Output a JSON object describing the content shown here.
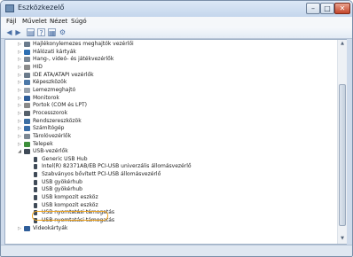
{
  "window": {
    "title": "Eszközkezelő"
  },
  "controls": {
    "minimize": "–",
    "maximize": "□",
    "close": "✕"
  },
  "menu": [
    "Fájl",
    "Művelet",
    "Nézet",
    "Súgó"
  ],
  "toolbar": [
    {
      "icon": "back-arrow-icon",
      "glyph": "◀"
    },
    {
      "icon": "forward-arrow-icon",
      "glyph": "▶"
    },
    {
      "icon": "properties-icon",
      "glyph": "▤"
    },
    {
      "icon": "help-icon",
      "glyph": "?"
    },
    {
      "icon": "list-view-icon",
      "glyph": "▦"
    },
    {
      "icon": "scan-hardware-icon",
      "glyph": "⚙"
    }
  ],
  "tree": {
    "categories": [
      {
        "label": "Hajlékonylemezes meghajtók vezérlői",
        "icon": "floppy-controller-icon",
        "color": "#6b7b8c"
      },
      {
        "label": "Hálózati kártyák",
        "icon": "network-adapter-icon",
        "color": "#2e6fb2"
      },
      {
        "label": "Hang-, videó- és játékvezérlők",
        "icon": "sound-video-icon",
        "color": "#7a8795"
      },
      {
        "label": "HID",
        "icon": "hid-icon",
        "color": "#8c8c8c"
      },
      {
        "label": "IDE ATA/ATAPI vezérlők",
        "icon": "ide-controller-icon",
        "color": "#6b7b8c"
      },
      {
        "label": "Képeszközök",
        "icon": "imaging-device-icon",
        "color": "#4d79a8"
      },
      {
        "label": "Lemezmeghajtó",
        "icon": "disk-drive-icon",
        "color": "#9aa3ad"
      },
      {
        "label": "Monitorok",
        "icon": "monitor-icon",
        "color": "#2f5e9a"
      },
      {
        "label": "Portok (COM és LPT)",
        "icon": "port-icon",
        "color": "#8a8a8a"
      },
      {
        "label": "Processzorok",
        "icon": "processor-icon",
        "color": "#55606b"
      },
      {
        "label": "Rendszereszközök",
        "icon": "system-device-icon",
        "color": "#3d6fa3"
      },
      {
        "label": "Számítógép",
        "icon": "computer-icon",
        "color": "#3a6ea8"
      },
      {
        "label": "Tárolóvezérlők",
        "icon": "storage-controller-icon",
        "color": "#7c8894"
      },
      {
        "label": "Telepek",
        "icon": "battery-icon",
        "color": "#3c8f3a"
      },
      {
        "label": "USB-vezérlők",
        "icon": "usb-controller-icon",
        "color": "#3f4a57",
        "expanded": true
      }
    ],
    "usb_children": [
      "Generic USB Hub",
      "Intel(R) 82371AB/EB PCI-USB univerzális állomásvezérlő",
      "Szabványos bővített PCI-USB állomásvezérlő",
      "USB gyökérhub",
      "USB gyökérhub",
      "USB kompozit eszköz",
      "USB kompozit eszköz",
      "USB nyomtatási támogatás",
      "USB nyomtatási támogatás"
    ],
    "last_category": {
      "label": "Videokártyák",
      "icon": "display-adapter-icon",
      "color": "#2f5e9a"
    }
  },
  "highlight_color": "#f0a41e"
}
